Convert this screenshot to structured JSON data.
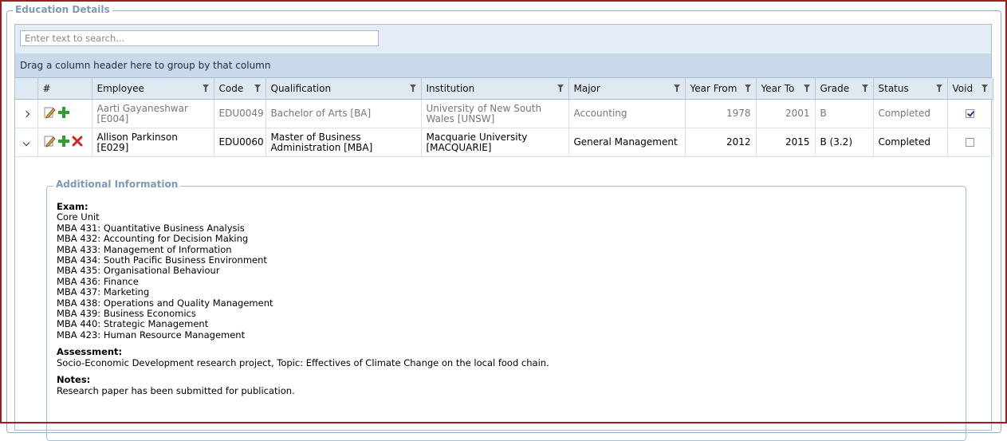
{
  "panel": {
    "title": "Education Details"
  },
  "search": {
    "placeholder": "Enter text to search..."
  },
  "group_panel": {
    "text": "Drag a column header here to group by that column"
  },
  "columns": [
    "#",
    "Employee",
    "Code",
    "Qualification",
    "Institution",
    "Major",
    "Year From",
    "Year To",
    "Grade",
    "Status",
    "Void"
  ],
  "rows": [
    {
      "employee": "Aarti Gayaneshwar [E004]",
      "code": "EDU0049",
      "qualification": "Bachelor of Arts [BA]",
      "institution": "University of New South Wales [UNSW]",
      "major": "Accounting",
      "year_from": "1978",
      "year_to": "2001",
      "grade": "B",
      "status": "Completed",
      "void": true,
      "expanded": false
    },
    {
      "employee": "Allison Parkinson [E029]",
      "code": "EDU0060",
      "qualification": "Master of Business Administration [MBA]",
      "institution": "Macquarie University [MACQUARIE]",
      "major": "General Management",
      "year_from": "2012",
      "year_to": "2015",
      "grade": "B (3.2)",
      "status": "Completed",
      "void": false,
      "expanded": true
    }
  ],
  "detail": {
    "title": "Additional Information",
    "exam_label": "Exam:",
    "exam_lines": [
      "Core Unit",
      "MBA 431: Quantitative Business Analysis",
      "MBA 432: Accounting for Decision Making",
      "MBA 433: Management of Information",
      "MBA 434: South Pacific Business Environment",
      "MBA 435: Organisational Behaviour",
      "MBA 436: Finance",
      "MBA 437: Marketing",
      "MBA 438: Operations and Quality Management",
      "MBA 439: Business Economics",
      "MBA 440: Strategic Management",
      "MBA 423: Human Resource Management"
    ],
    "assessment_label": "Assessment:",
    "assessment_text": "Socio-Economic Development research project, Topic: Effectives of Climate Change on the local food chain.",
    "notes_label": "Notes:",
    "notes_text": "Research paper has been submitted for publication."
  },
  "colors": {
    "frame_border": "#a31a21",
    "header_bg": "#dfe9f4",
    "group_panel_bg": "#c9d9ea",
    "legend_text": "#7f98b9",
    "edit_icon": "#c08a2a",
    "add_icon": "#2f9e2f",
    "delete_icon": "#d8231f"
  }
}
